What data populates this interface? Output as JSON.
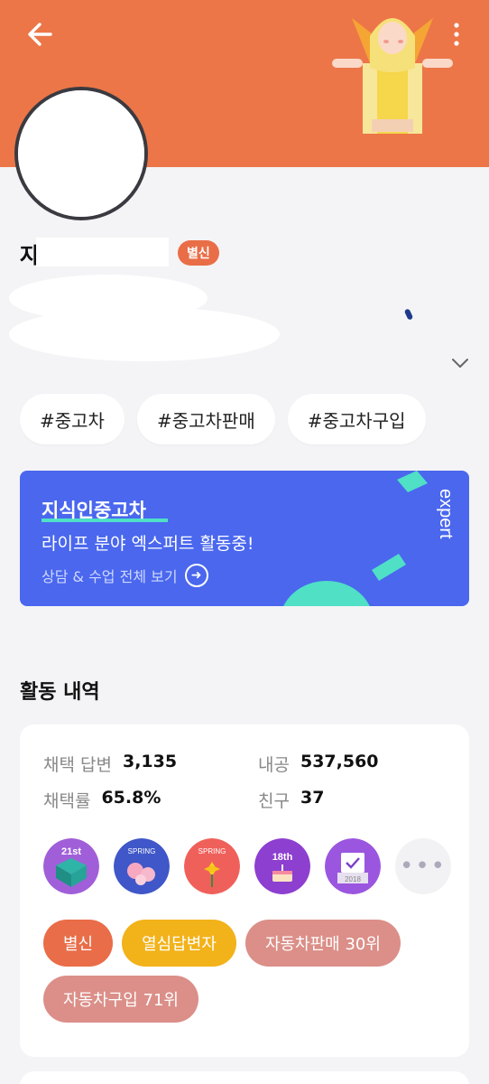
{
  "header": {
    "background_color": "#ec7648",
    "back_icon": "arrow-left-icon",
    "more_icon": "vertical-dots-icon"
  },
  "profile": {
    "name_visible_prefix": "자",
    "level_badge": "별신"
  },
  "tags": [
    "#중고차",
    "#중고차판매",
    "#중고차구입"
  ],
  "expert_card": {
    "title": "지식인중고차",
    "subtitle": "라이프 분야 엑스퍼트 활동중!",
    "link_text": "상담 & 수업 전체 보기",
    "side_text": "expert",
    "background_color": "#4a67ee"
  },
  "activity": {
    "section_title": "활동 내역",
    "stats": [
      {
        "label": "채택 답변",
        "value": "3,135"
      },
      {
        "label": "내공",
        "value": "537,560"
      },
      {
        "label": "채택률",
        "value": "65.8%"
      },
      {
        "label": "친구",
        "value": "37"
      }
    ],
    "badges": [
      {
        "icon": "21st-anniversary-badge-icon",
        "text": "21st"
      },
      {
        "icon": "spring-blossom-badge-icon",
        "text": "SPRING"
      },
      {
        "icon": "spring-forsythia-badge-icon",
        "text": "SPRING"
      },
      {
        "icon": "18th-birthday-cake-badge-icon",
        "text": "18th"
      },
      {
        "icon": "2018-ballot-box-badge-icon",
        "text": "2018"
      }
    ],
    "rank_pills": [
      {
        "label": "별신",
        "color": "#e96d48"
      },
      {
        "label": "열심답변자",
        "color": "#f2b21a"
      },
      {
        "label": "자동차판매 30위",
        "color": "#db8f88"
      },
      {
        "label": "자동차구입 71위",
        "color": "#db8f88"
      }
    ]
  }
}
